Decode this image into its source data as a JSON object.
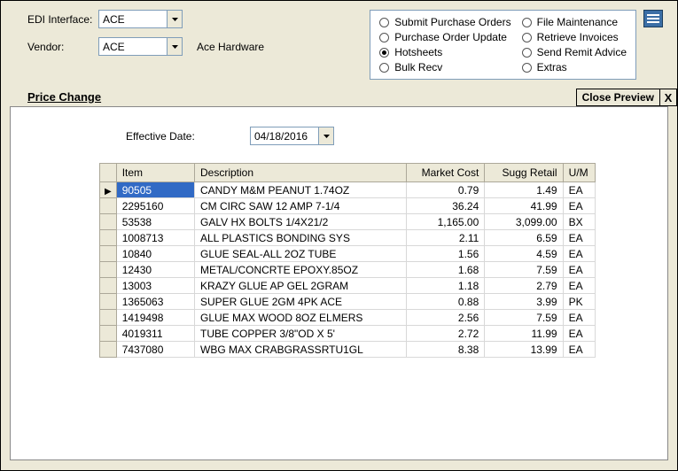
{
  "header": {
    "edi_label": "EDI Interface:",
    "edi_value": "ACE",
    "vendor_label": "Vendor:",
    "vendor_value": "ACE",
    "vendor_name": "Ace Hardware"
  },
  "radios": {
    "col1": [
      {
        "label": "Submit Purchase Orders",
        "selected": false
      },
      {
        "label": "Purchase Order Update",
        "selected": false
      },
      {
        "label": "Hotsheets",
        "selected": true
      },
      {
        "label": "Bulk Recv",
        "selected": false
      }
    ],
    "col2": [
      {
        "label": "File Maintenance",
        "selected": false
      },
      {
        "label": "Retrieve Invoices",
        "selected": false
      },
      {
        "label": "Send Remit Advice",
        "selected": false
      },
      {
        "label": "Extras",
        "selected": false
      }
    ]
  },
  "section": {
    "title": "Price Change",
    "close_label": "Close Preview",
    "x_label": "X"
  },
  "effective": {
    "label": "Effective Date:",
    "value": "04/18/2016"
  },
  "table": {
    "columns": {
      "item": "Item",
      "description": "Description",
      "market_cost": "Market Cost",
      "sugg_retail": "Sugg Retail",
      "um": "U/M"
    },
    "rows": [
      {
        "item": "90505",
        "description": "CANDY M&M PEANUT 1.74OZ",
        "market_cost": "0.79",
        "sugg_retail": "1.49",
        "um": "EA",
        "current": true,
        "selected": true
      },
      {
        "item": "2295160",
        "description": "CM CIRC SAW 12 AMP 7-1/4",
        "market_cost": "36.24",
        "sugg_retail": "41.99",
        "um": "EA"
      },
      {
        "item": "53538",
        "description": "GALV HX BOLTS 1/4X21/2",
        "market_cost": "1,165.00",
        "sugg_retail": "3,099.00",
        "um": "BX"
      },
      {
        "item": "1008713",
        "description": "ALL PLASTICS BONDING SYS",
        "market_cost": "2.11",
        "sugg_retail": "6.59",
        "um": "EA"
      },
      {
        "item": "10840",
        "description": "GLUE SEAL-ALL 2OZ TUBE",
        "market_cost": "1.56",
        "sugg_retail": "4.59",
        "um": "EA"
      },
      {
        "item": "12430",
        "description": "METAL/CONCRTE EPOXY.85OZ",
        "market_cost": "1.68",
        "sugg_retail": "7.59",
        "um": "EA"
      },
      {
        "item": "13003",
        "description": "KRAZY GLUE AP GEL 2GRAM",
        "market_cost": "1.18",
        "sugg_retail": "2.79",
        "um": "EA"
      },
      {
        "item": "1365063",
        "description": "SUPER GLUE 2GM 4PK ACE",
        "market_cost": "0.88",
        "sugg_retail": "3.99",
        "um": "PK"
      },
      {
        "item": "1419498",
        "description": "GLUE MAX WOOD 8OZ ELMERS",
        "market_cost": "2.56",
        "sugg_retail": "7.59",
        "um": "EA"
      },
      {
        "item": "4019311",
        "description": "TUBE COPPER 3/8\"OD X 5'",
        "market_cost": "2.72",
        "sugg_retail": "11.99",
        "um": "EA"
      },
      {
        "item": "7437080",
        "description": "WBG MAX  CRABGRASSRTU1GL",
        "market_cost": "8.38",
        "sugg_retail": "13.99",
        "um": "EA"
      }
    ]
  }
}
